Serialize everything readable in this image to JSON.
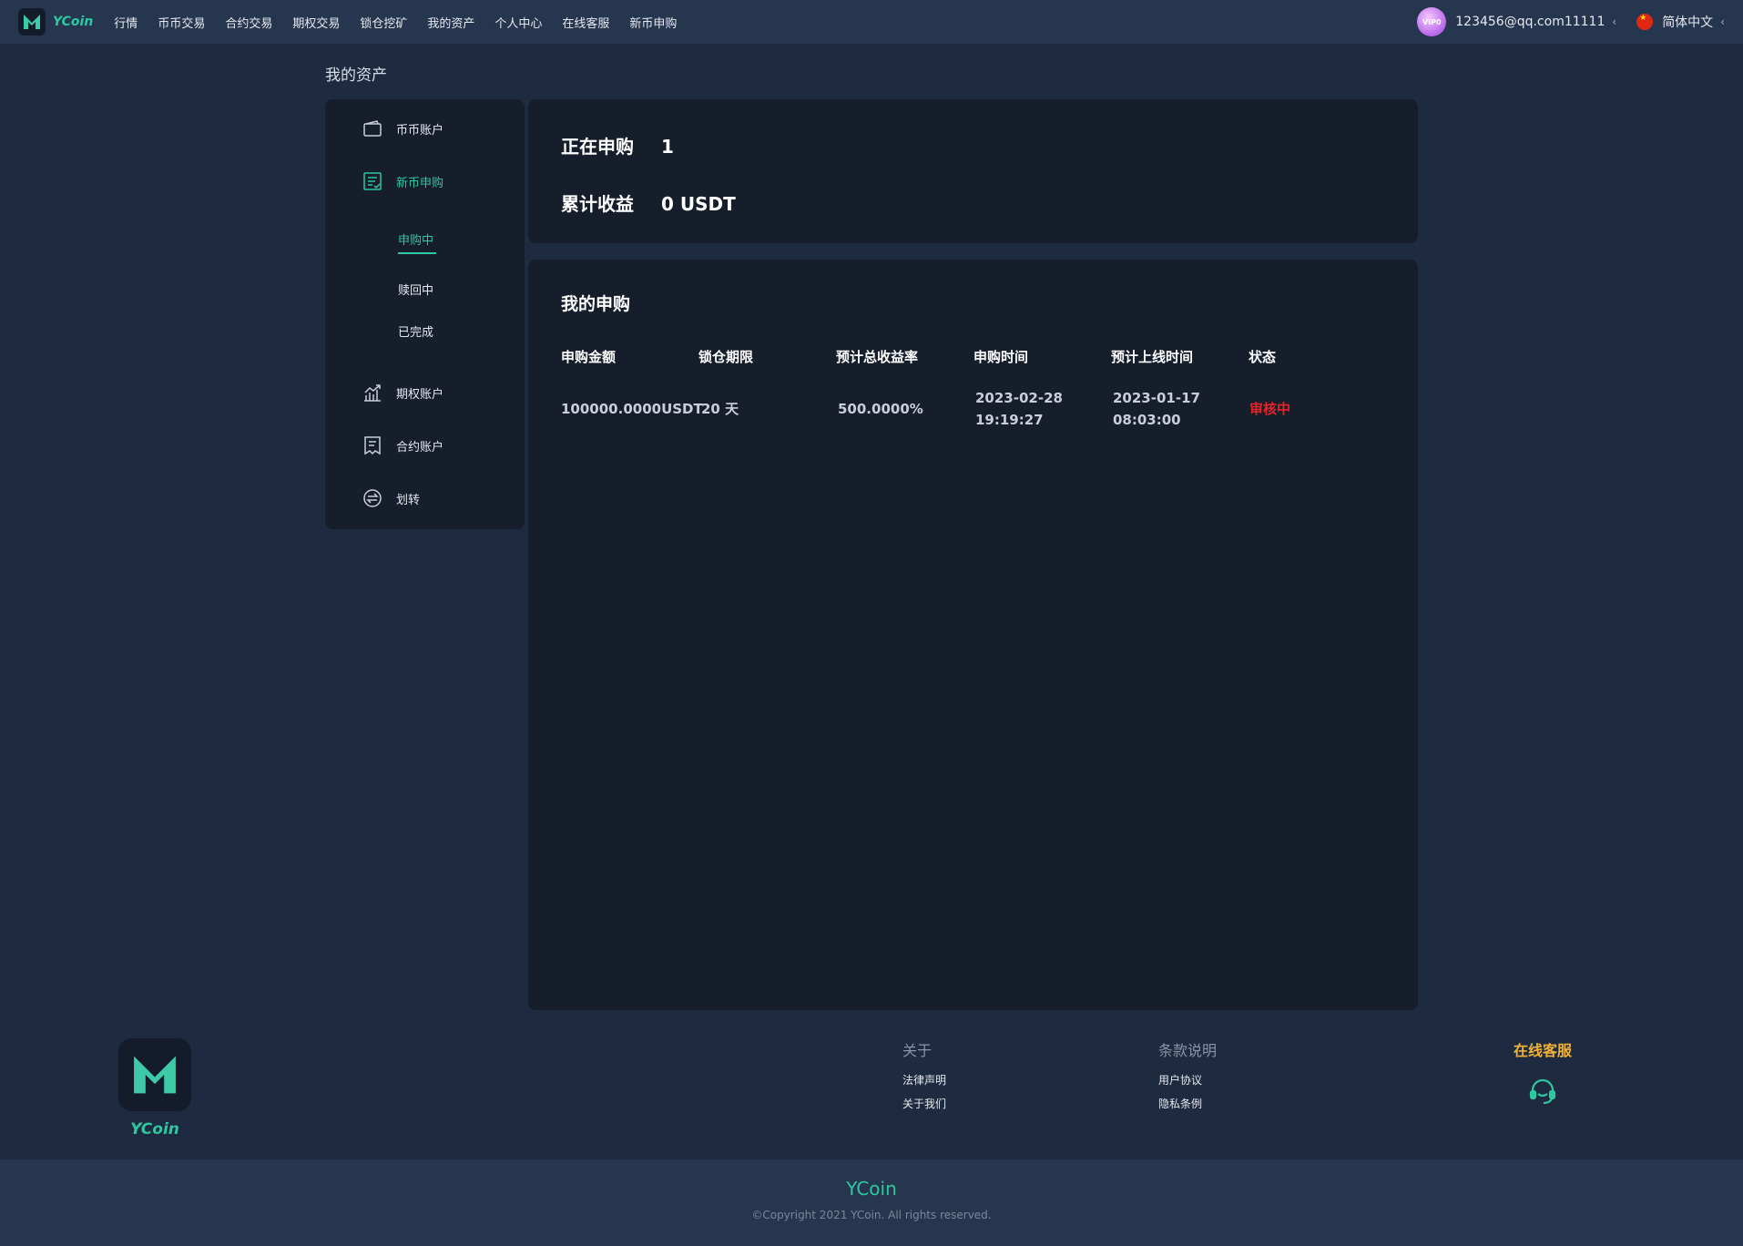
{
  "header": {
    "brand": "YCoin",
    "nav": [
      "行情",
      "币币交易",
      "合约交易",
      "期权交易",
      "锁仓挖矿",
      "我的资产",
      "个人中心",
      "在线客服",
      "新币申购"
    ],
    "avatar_text": "VIP0",
    "user_email": "123456@qq.com11111",
    "language": "简体中文"
  },
  "page_title": "我的资产",
  "sidebar": {
    "items": [
      {
        "label": "币币账户",
        "icon": "wallet-icon"
      },
      {
        "label": "新币申购",
        "icon": "subscription-doc-icon",
        "active": true
      },
      {
        "label": "期权账户",
        "icon": "chart-icon"
      },
      {
        "label": "合约账户",
        "icon": "contract-doc-icon"
      },
      {
        "label": "划转",
        "icon": "transfer-icon"
      }
    ],
    "subitems": [
      "申购中",
      "赎回中",
      "已完成"
    ]
  },
  "summary": {
    "subscribing_label": "正在申购",
    "subscribing_value": "1",
    "earnings_label": "累计收益",
    "earnings_value": "0 USDT"
  },
  "subscriptions": {
    "title": "我的申购",
    "columns": [
      "申购金额",
      "锁仓期限",
      "预计总收益率",
      "申购时间",
      "预计上线时间",
      "状态"
    ],
    "rows": [
      {
        "amount": "100000.0000USDT",
        "term": "20 天",
        "rate": "500.0000%",
        "time_date": "2023-02-28",
        "time_clock": "19:19:27",
        "launch_date": "2023-01-17",
        "launch_clock": "08:03:00",
        "status": "审核中"
      }
    ]
  },
  "footer": {
    "brand": "YCoin",
    "about_title": "关于",
    "about_links": [
      "法律声明",
      "关于我们"
    ],
    "terms_title": "条款说明",
    "terms_links": [
      "用户协议",
      "隐私条例"
    ],
    "support_title": "在线客服",
    "bottom_brand": "YCoin",
    "copyright": "©Copyright 2021 YCoin. All rights reserved."
  },
  "colors": {
    "accent": "#2fc7a0",
    "status_red": "#e8232a",
    "support_gold": "#f2b233"
  }
}
